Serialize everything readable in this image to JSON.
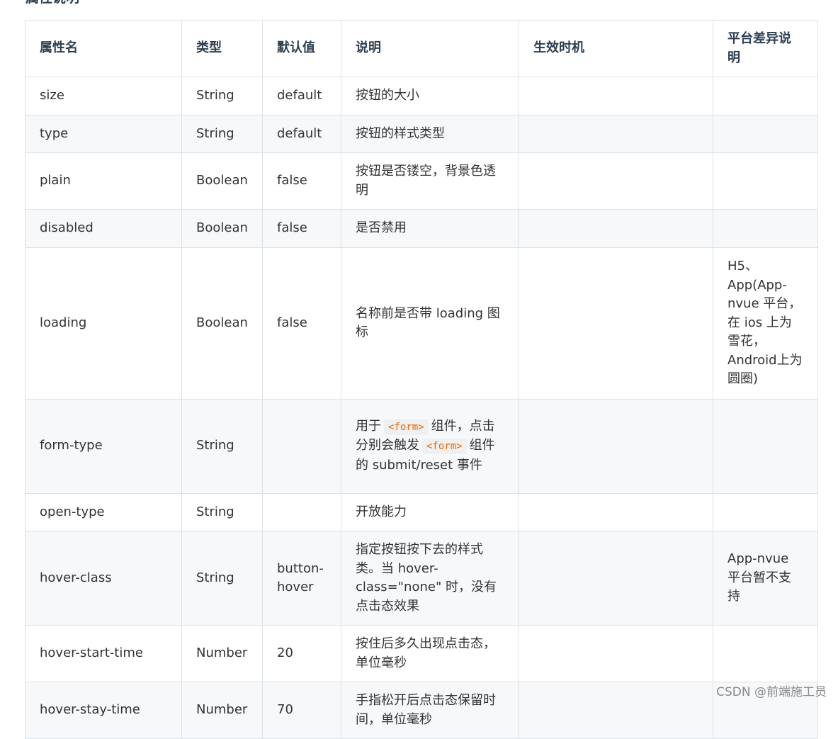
{
  "section_title": "属性说明",
  "table": {
    "headers": [
      "属性名",
      "类型",
      "默认值",
      "说明",
      "生效时机",
      "平台差异说明"
    ],
    "rows": [
      {
        "name": "size",
        "type": "String",
        "default": "default",
        "desc": "按钮的大小",
        "timing": "",
        "platform": ""
      },
      {
        "name": "type",
        "type": "String",
        "default": "default",
        "desc": "按钮的样式类型",
        "timing": "",
        "platform": ""
      },
      {
        "name": "plain",
        "type": "Boolean",
        "default": "false",
        "desc": "按钮是否镂空，背景色透明",
        "timing": "",
        "platform": ""
      },
      {
        "name": "disabled",
        "type": "Boolean",
        "default": "false",
        "desc": "是否禁用",
        "timing": "",
        "platform": ""
      },
      {
        "name": "loading",
        "type": "Boolean",
        "default": "false",
        "desc": "名称前是否带 loading 图标",
        "timing": "",
        "platform": "H5、App(App-nvue 平台，在 ios 上为雪花，Android上为圆圈)"
      },
      {
        "name": "form-type",
        "type": "String",
        "default": "",
        "desc_parts": [
          "用于",
          "<form>",
          "组件，点击分别会触发",
          "<form>",
          "组件的 submit/reset 事件"
        ],
        "timing": "",
        "platform": ""
      },
      {
        "name": "open-type",
        "type": "String",
        "default": "",
        "desc": "开放能力",
        "timing": "",
        "platform": ""
      },
      {
        "name": "hover-class",
        "type": "String",
        "default": "button-hover",
        "desc": "指定按钮按下去的样式类。当 hover-class=\"none\" 时，没有点击态效果",
        "timing": "",
        "platform": "App-nvue 平台暂不支持"
      },
      {
        "name": "hover-start-time",
        "type": "Number",
        "default": "20",
        "desc": "按住后多久出现点击态，单位毫秒",
        "timing": "",
        "platform": ""
      },
      {
        "name": "hover-stay-time",
        "type": "Number",
        "default": "70",
        "desc": "手指松开后点击态保留时间，单位毫秒",
        "timing": "",
        "platform": ""
      }
    ]
  },
  "watermark": "CSDN @前端施工员"
}
